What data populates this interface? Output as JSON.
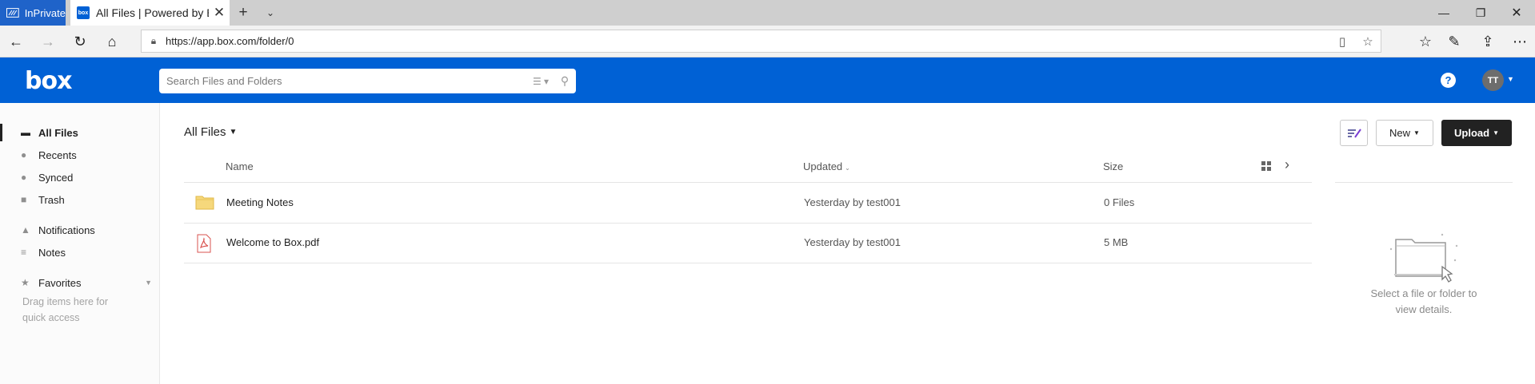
{
  "browser": {
    "inprivate_label": "InPrivate",
    "tab_title": "All Files | Powered by Box",
    "favicon_text": "box",
    "url": "https://app.box.com/folder/0"
  },
  "header": {
    "logo": "box",
    "search_placeholder": "Search Files and Folders",
    "help": "?",
    "avatar_initials": "TT",
    "brand_color": "#0061d5"
  },
  "sidebar": {
    "items": [
      {
        "label": "All Files",
        "icon": "folder-icon",
        "active": true
      },
      {
        "label": "Recents",
        "icon": "clock-icon"
      },
      {
        "label": "Synced",
        "icon": "sync-icon"
      },
      {
        "label": "Trash",
        "icon": "trash-icon"
      },
      {
        "label": "Notifications",
        "icon": "bell-icon"
      },
      {
        "label": "Notes",
        "icon": "notes-icon"
      },
      {
        "label": "Favorites",
        "icon": "star-icon"
      }
    ],
    "favorites_hint": "Drag items here for quick access"
  },
  "main": {
    "breadcrumb": "All Files",
    "buttons": {
      "new": "New",
      "upload": "Upload"
    },
    "columns": {
      "name": "Name",
      "updated": "Updated",
      "size": "Size"
    },
    "rows": [
      {
        "name": "Meeting Notes",
        "type": "folder",
        "updated": "Yesterday by test001",
        "size": "0 Files"
      },
      {
        "name": "Welcome to Box.pdf",
        "type": "pdf",
        "updated": "Yesterday by test001",
        "size": "5 MB"
      }
    ],
    "details_message": "Select a file or folder to view details."
  }
}
